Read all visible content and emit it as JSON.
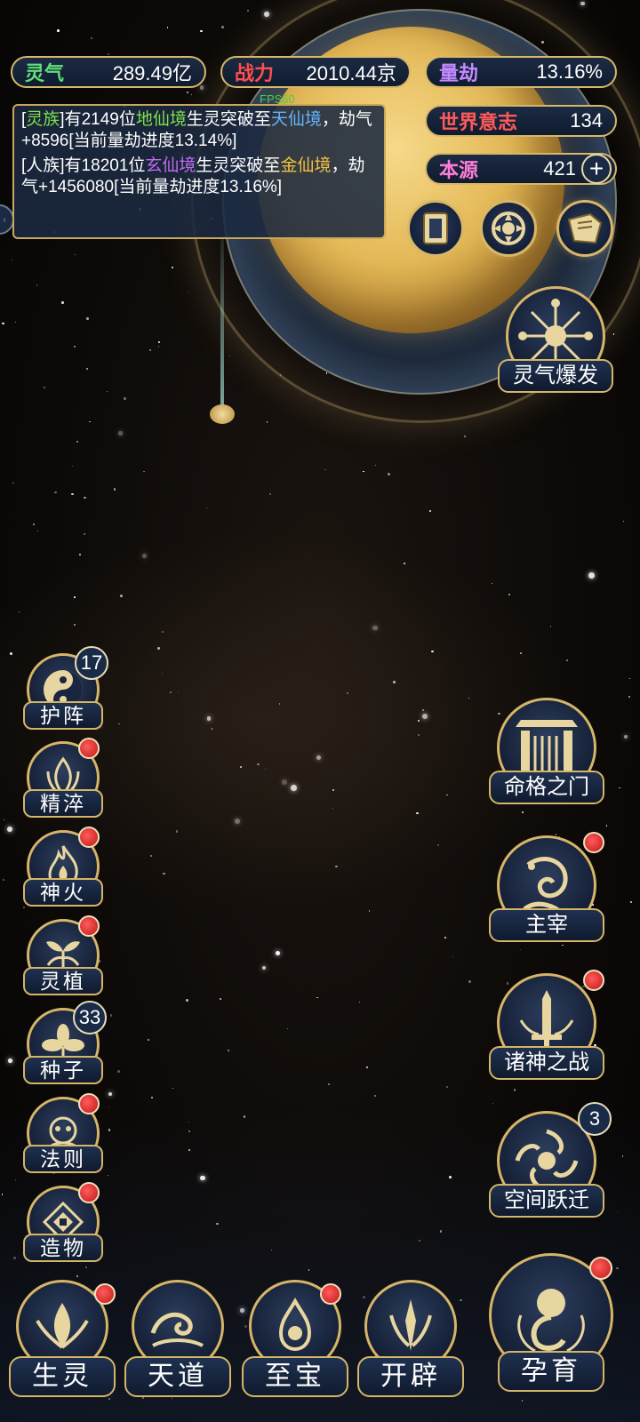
{
  "stats": {
    "lingqi": {
      "label": "灵气",
      "value": "289.49亿",
      "color": "#5fe07a"
    },
    "zhanli": {
      "label": "战力",
      "value": "2010.44京",
      "color": "#ff4e4e"
    },
    "liangjie": {
      "label": "量劫",
      "value": "13.16%",
      "color": "#c389ff"
    },
    "shijie": {
      "label": "世界意志",
      "value": "134",
      "color": "#ff5a5a"
    },
    "benyuan": {
      "label": "本源",
      "value": "421",
      "color": "#ff7dd8"
    }
  },
  "fps": "FPS60",
  "log": {
    "line1": {
      "a": "[",
      "race": "灵族",
      "b": "]有2149位",
      "realm_from": "地仙境",
      "c": "生灵突破至",
      "realm_to": "天仙境",
      "d": "，劫气+8596[当前量劫进度13.14%]"
    },
    "line2": {
      "a": "[人族]有18201位",
      "realm_from": "玄仙境",
      "c": "生灵突破至",
      "realm_to": "金仙境",
      "d": "，劫气+1456080[当前量劫进度13.16%]"
    }
  },
  "top_icons": [
    {
      "name": "card-icon"
    },
    {
      "name": "portal-icon"
    },
    {
      "name": "scroll-icon"
    }
  ],
  "burst": {
    "label": "灵气爆发"
  },
  "left_menu": [
    {
      "label": "护阵",
      "badge": "17"
    },
    {
      "label": "精淬"
    },
    {
      "label": "神火"
    },
    {
      "label": "灵植"
    },
    {
      "label": "种子",
      "badge": "33"
    },
    {
      "label": "法则"
    },
    {
      "label": "造物"
    }
  ],
  "right_menu": [
    {
      "label": "命格之门"
    },
    {
      "label": "主宰"
    },
    {
      "label": "诸神之战"
    },
    {
      "label": "空间跃迁",
      "badge": "3"
    }
  ],
  "bottom_menu": [
    {
      "label": "生灵"
    },
    {
      "label": "天道"
    },
    {
      "label": "至宝"
    },
    {
      "label": "开辟"
    },
    {
      "label": "孕育"
    }
  ],
  "plus_symbol": "+"
}
